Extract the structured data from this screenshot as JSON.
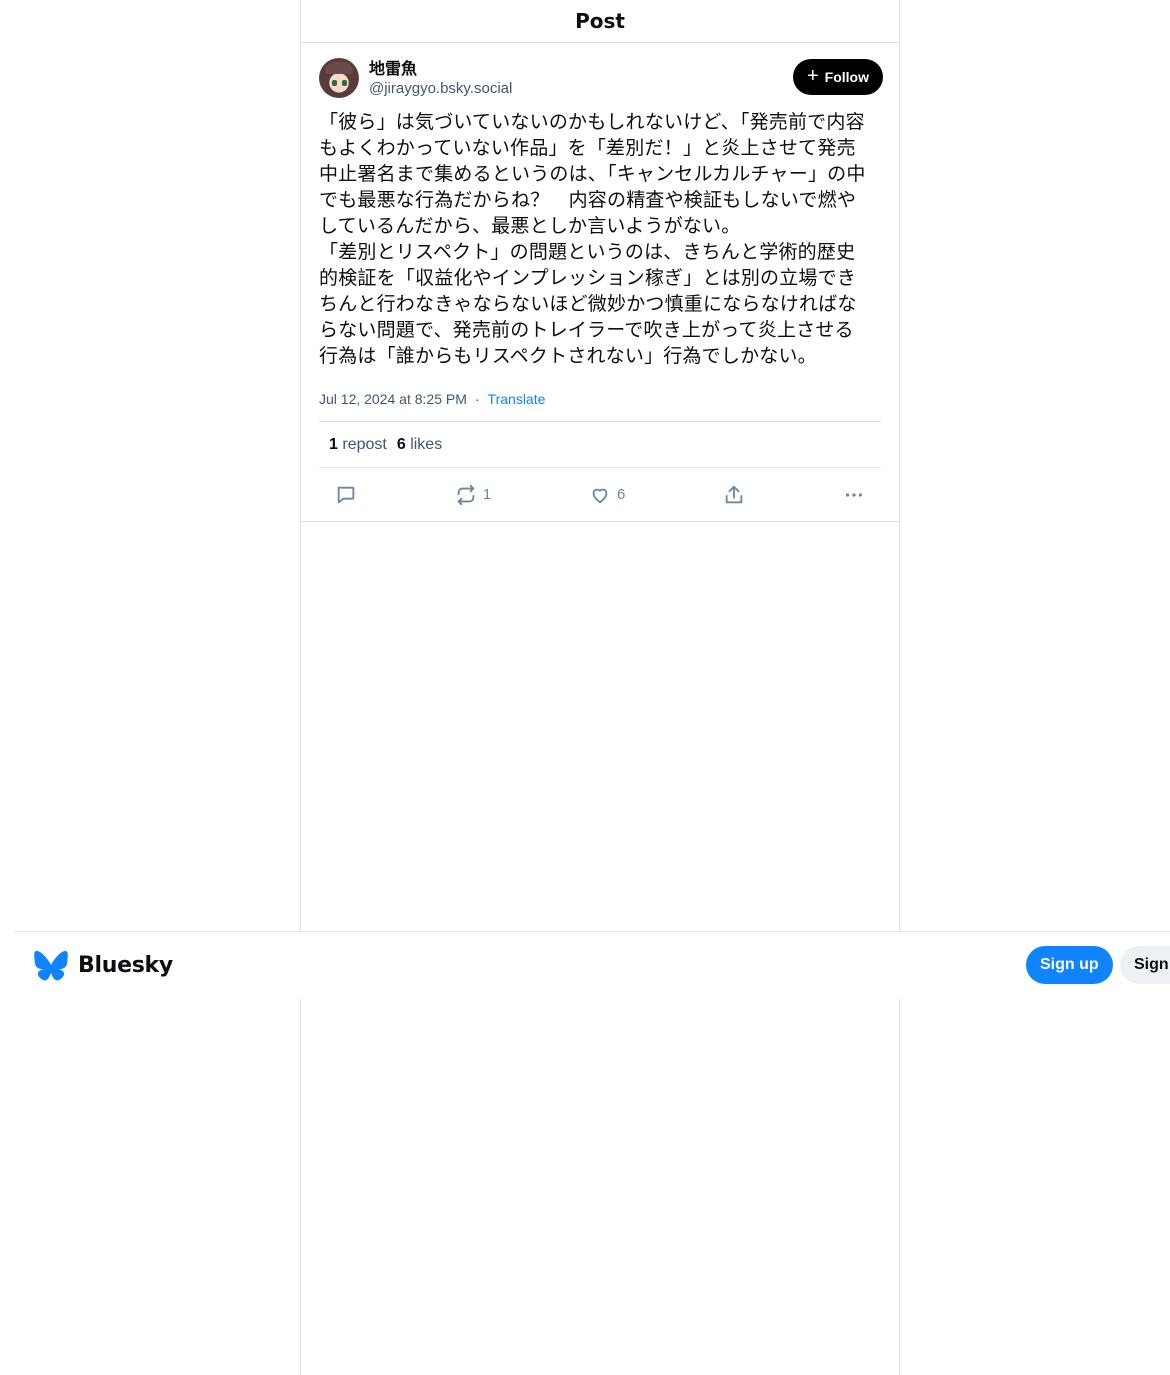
{
  "header": {
    "title": "Post"
  },
  "author": {
    "display_name": "地雷魚",
    "handle": "@jiraygyo.bsky.social"
  },
  "follow": {
    "label": "Follow"
  },
  "post": {
    "text": "「彼ら」は気づいていないのかもしれないけど、「発売前で内容もよくわかっていない作品」を「差別だ！」と炎上させて発売中止署名まで集めるというのは、「キャンセルカルチャー」の中でも最悪な行為だからね？　内容の精査や検証もしないで燃やしているんだから、最悪としか言いようがない。\n「差別とリスペクト」の問題というのは、きちんと学術的歴史的検証を「収益化やインプレッション稼ぎ」とは別の立場できちんと行わなきゃならないほど微妙かつ慎重にならなければならない問題で、発売前のトレイラーで吹き上がって炎上させる行為は「誰からもリスペクトされない」行為でしかない。",
    "timestamp": "Jul 12, 2024 at 8:25 PM",
    "separator": "·",
    "translate_label": "Translate"
  },
  "stats": {
    "reposts_count": "1",
    "reposts_label": "repost",
    "likes_count": "6",
    "likes_label": "likes"
  },
  "actions": {
    "repost_count": "1",
    "like_count": "6"
  },
  "bottom_bar": {
    "brand": "Bluesky",
    "signup_label": "Sign up",
    "signin_label": "Sign in"
  },
  "colors": {
    "accent": "#1083fe",
    "border": "#dfe3e8",
    "muted": "#42576c"
  }
}
